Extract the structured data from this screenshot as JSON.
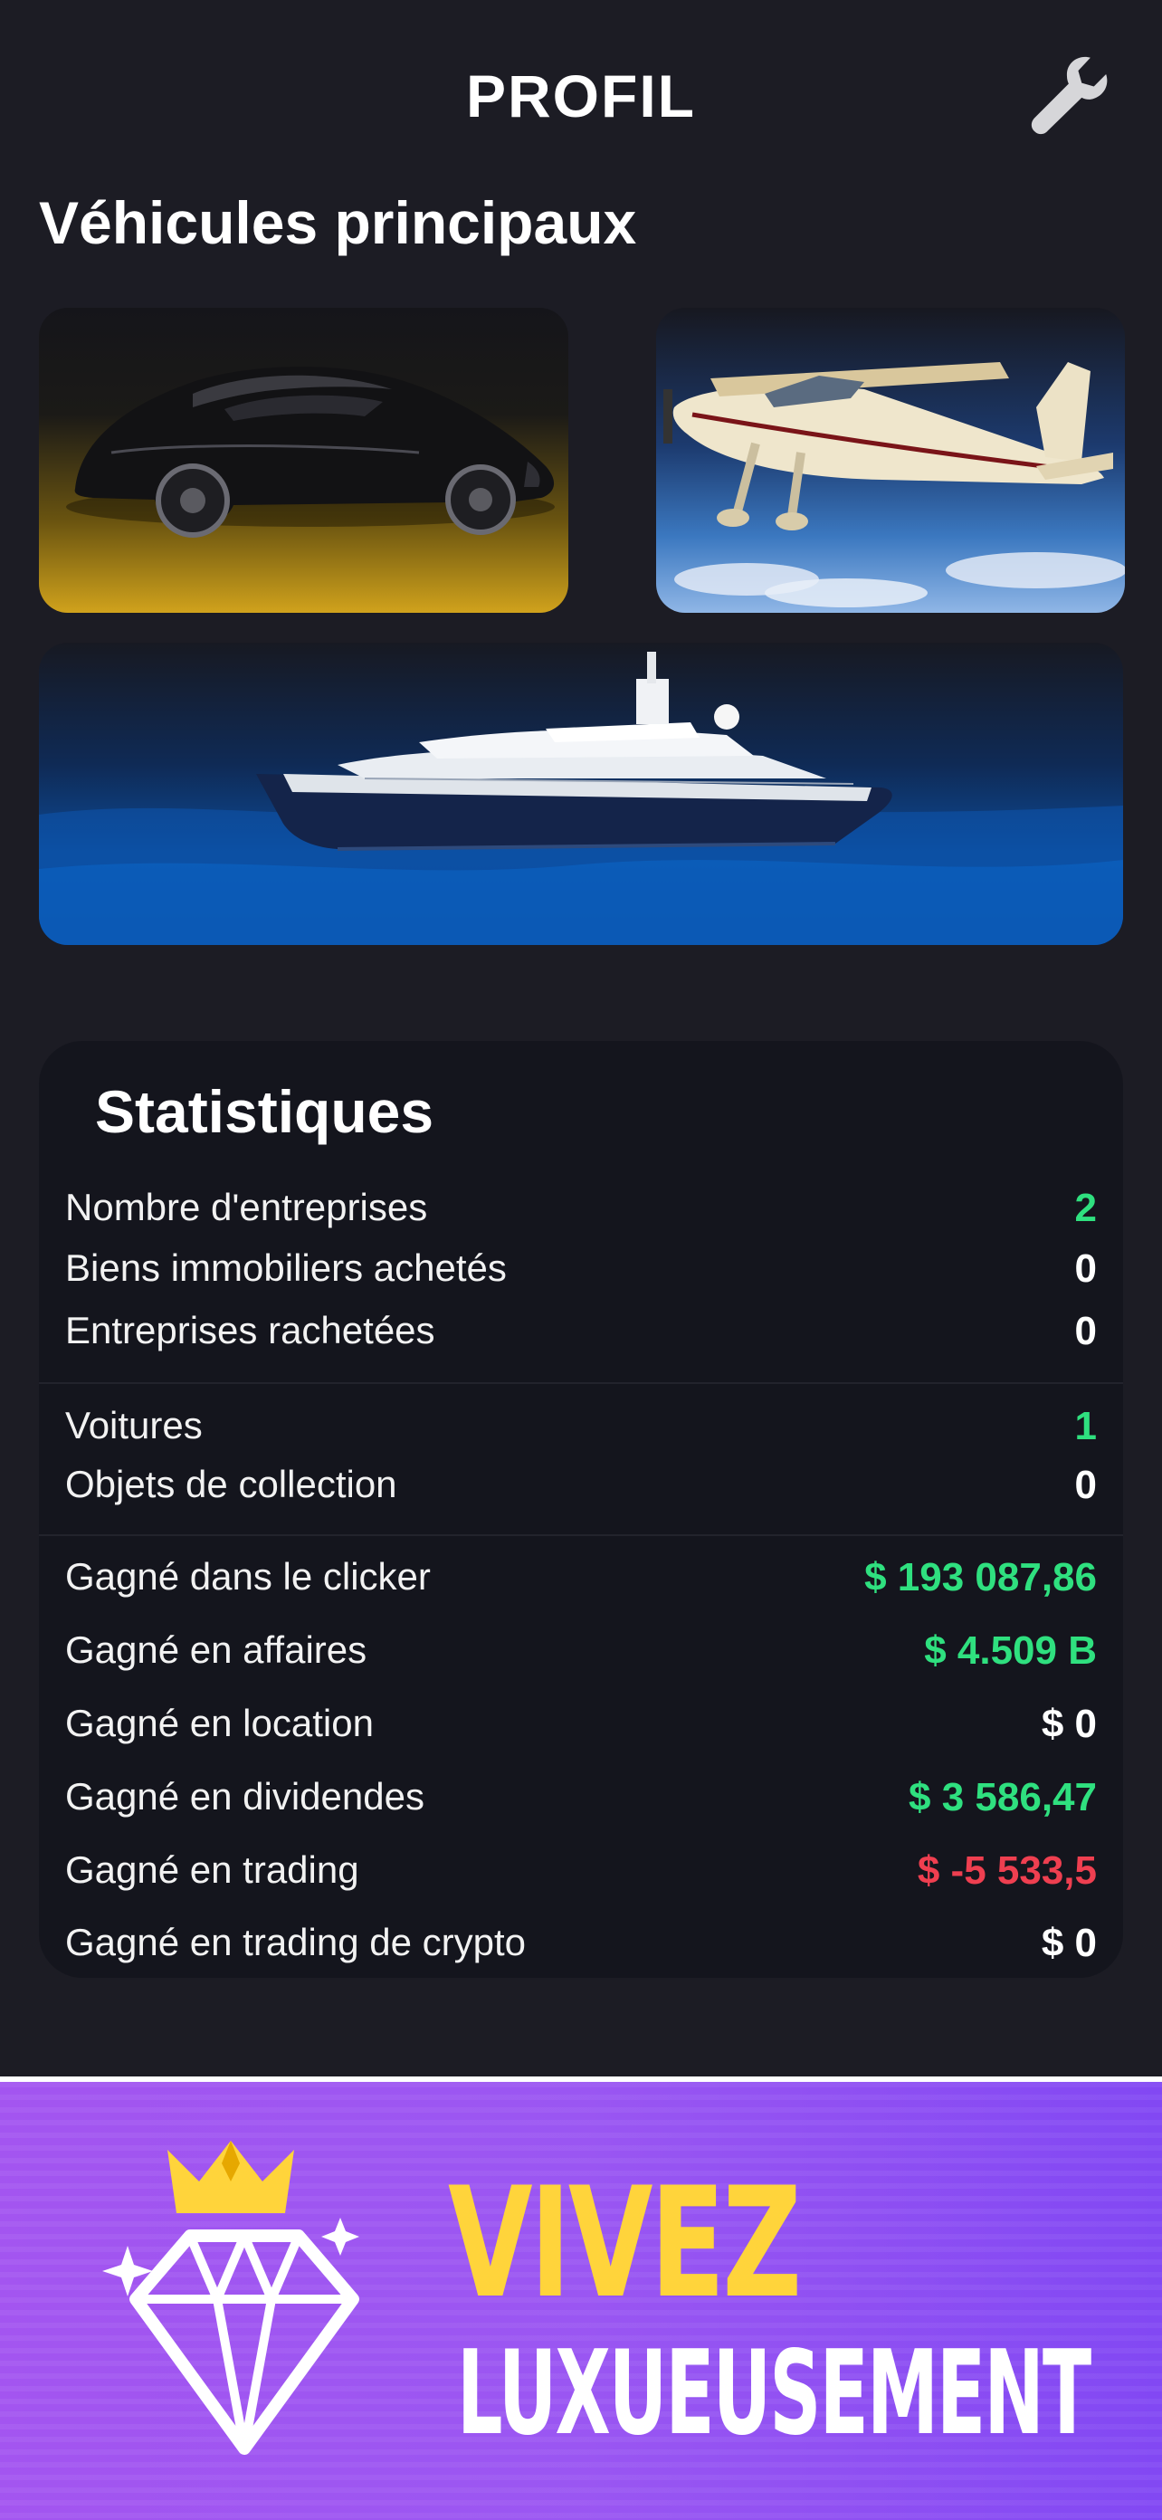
{
  "header": {
    "title": "PROFIL",
    "settings_icon": "wrench-icon"
  },
  "vehicles": {
    "section_title": "Véhicules principaux",
    "items": [
      {
        "kind": "car",
        "icon": "car-image"
      },
      {
        "kind": "plane",
        "icon": "plane-image"
      },
      {
        "kind": "yacht",
        "icon": "yacht-image"
      }
    ]
  },
  "stats": {
    "title": "Statistiques",
    "groups": [
      [
        {
          "label": "Nombre d'entreprises",
          "value": "2",
          "color": "#2fe07f"
        },
        {
          "label": "Biens immobiliers achetés",
          "value": "0",
          "color": "#ffffff"
        },
        {
          "label": "Entreprises rachetées",
          "value": "0",
          "color": "#ffffff"
        }
      ],
      [
        {
          "label": "Voitures",
          "value": "1",
          "color": "#2fe07f"
        },
        {
          "label": "Objets de collection",
          "value": "0",
          "color": "#ffffff"
        }
      ],
      [
        {
          "label": "Gagné dans le clicker",
          "value": "$ 193 087,86",
          "color": "#2fe07f"
        },
        {
          "label": "Gagné en affaires",
          "value": "$ 4.509 B",
          "color": "#2fe07f"
        },
        {
          "label": "Gagné en location",
          "value": "$ 0",
          "color": "#ffffff"
        },
        {
          "label": "Gagné en dividendes",
          "value": "$ 3 586,47",
          "color": "#2fe07f"
        },
        {
          "label": "Gagné en trading",
          "value": "$ -5 533,5",
          "color": "#ef3f50"
        },
        {
          "label": "Gagné en trading de crypto",
          "value": "$ 0",
          "color": "#ffffff"
        }
      ]
    ]
  },
  "banner": {
    "line1": "VIVEZ",
    "line2": "LUXUEUSEMENT",
    "icon": "diamond-crown-icon"
  },
  "colors": {
    "background": "#1c1c24",
    "card": "#14151d",
    "positive": "#2fe07f",
    "negative": "#ef3f50",
    "banner_text": "#ffd43b"
  }
}
